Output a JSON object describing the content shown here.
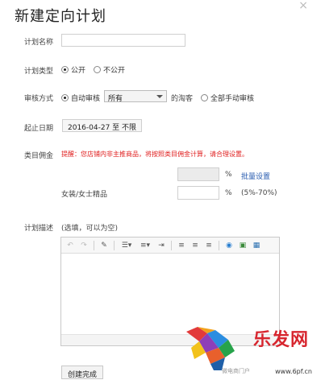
{
  "dialog": {
    "title": "新建定向计划",
    "close_symbol": "×"
  },
  "form": {
    "plan_name": {
      "label": "计划名称",
      "value": ""
    },
    "plan_type": {
      "label": "计划类型",
      "options": [
        {
          "label": "公开",
          "selected": true
        },
        {
          "label": "不公开",
          "selected": false
        }
      ]
    },
    "review": {
      "label": "审核方式",
      "auto_label": "自动审核",
      "auto_selected": true,
      "select_value": "所有",
      "suffix": "的淘客",
      "manual_label": "全部手动审核",
      "manual_selected": false
    },
    "dates": {
      "label": "起止日期",
      "value": "2016-04-27 至 不限"
    },
    "commission": {
      "label": "类目佣金",
      "warning": "提醒：您店铺内非主推商品，将按照类目佣金计算，请合理设置。",
      "percent_symbol": "%",
      "batch_link": "批量设置",
      "category_label": "女装/女士精品",
      "category_value": "",
      "range_hint": "(5%-70%)"
    },
    "description": {
      "label": "计划描述",
      "hint": "(选填，可以为空)"
    },
    "submit_label": "创建完成"
  },
  "watermark": {
    "brand": "乐发网",
    "url": "www.6pf.cn",
    "sub": "微电商门户"
  },
  "colors": {
    "warning": "#e02020",
    "link": "#2a5db0",
    "brand": "#d7262f"
  }
}
